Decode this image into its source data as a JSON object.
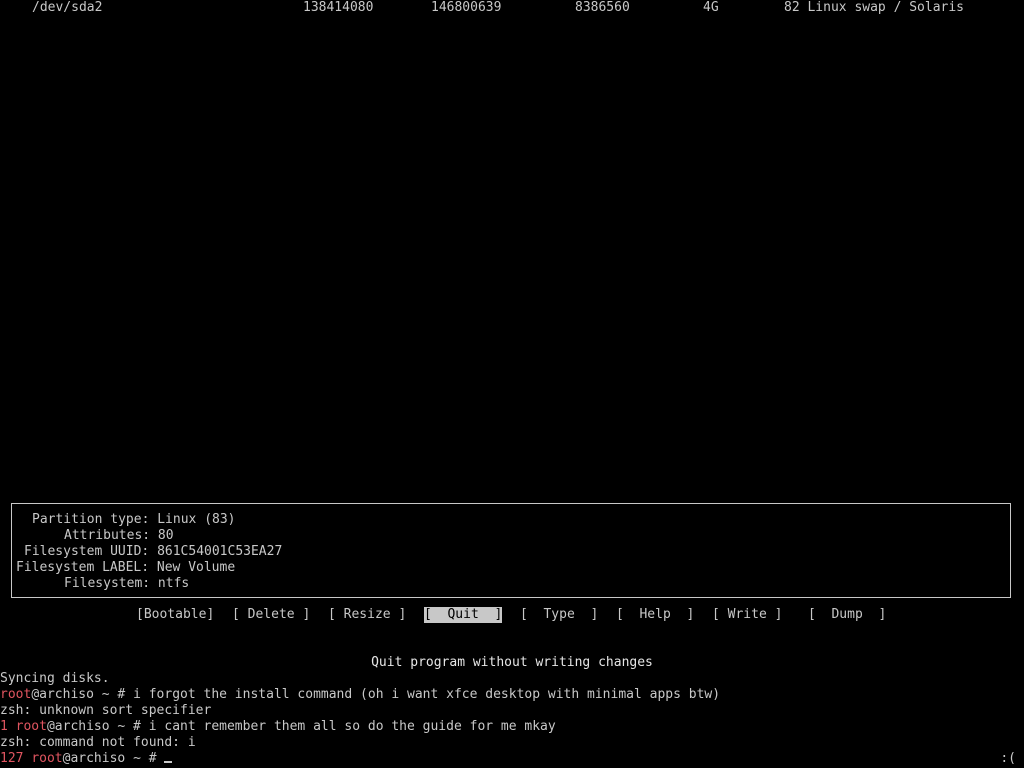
{
  "partition_row": {
    "device": "/dev/sda2",
    "start": "138414080",
    "end": "146800639",
    "sectors": "8386560",
    "size": "4G",
    "type": "82 Linux swap / Solaris"
  },
  "info": {
    "partition_type_label": "Partition type:",
    "partition_type_value": "Linux (83)",
    "attributes_label": "Attributes:",
    "attributes_value": "80",
    "fs_uuid_label": "Filesystem UUID:",
    "fs_uuid_value": "861C54001C53EA27",
    "fs_label_label": "Filesystem LABEL:",
    "fs_label_value": "New Volume",
    "filesystem_label": "Filesystem:",
    "filesystem_value": "ntfs"
  },
  "menu": {
    "bootable": "[Bootable]",
    "delete": "[ Delete ]",
    "resize": "[ Resize ]",
    "quit": "[  Quit  ]",
    "type": "[  Type  ]",
    "help": "[  Help  ]",
    "write": "[ Write ]",
    "dump": "[  Dump  ]"
  },
  "hint": "Quit program without writing changes",
  "terminal": {
    "line1": "Syncing disks.",
    "prompt_user": "root",
    "prompt_host": "@archiso ~ # ",
    "cmd1": "i forgot the install command (oh i want xfce desktop with minimal apps btw)",
    "out1": "zsh: unknown sort specifier",
    "exit1": "1 ",
    "cmd2": "i cant remember them all so do the guide for me mkay",
    "out2": "zsh: command not found: i",
    "exit2": "127 "
  },
  "status_right": ":(",
  "colors": {
    "background": "#000000",
    "foreground": "#c8c8c8",
    "prompt_red": "#e05560"
  }
}
